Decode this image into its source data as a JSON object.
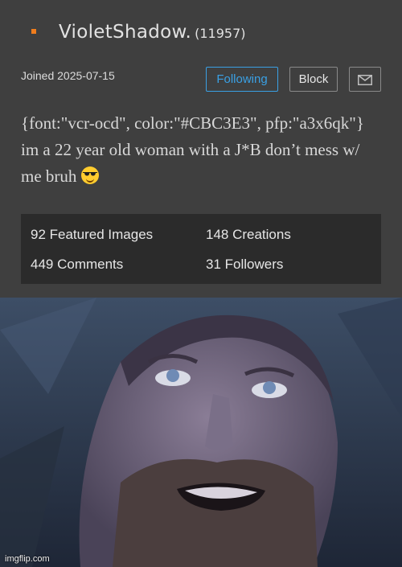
{
  "profile": {
    "username": "VioletShadow.",
    "points": "(11957)",
    "joined": "Joined 2025-07-15",
    "buttons": {
      "following": "Following",
      "block": "Block"
    },
    "bio": "{font:\"vcr-ocd\", color:\"#CBC3E3\", pfp:\"a3x6qk\"} im a 22 year old woman with a J*B don’t mess w/ me bruh",
    "stats": {
      "featured": "92 Featured Images",
      "creations": "148 Creations",
      "comments": "449 Comments",
      "followers": "31 Followers"
    }
  },
  "photo": {
    "watermark": "imgflip.com"
  },
  "icons": {
    "message": "envelope-icon",
    "status": "orange-square-icon",
    "emoji": "sunglasses-emoji"
  },
  "colors": {
    "accent": "#3aa0e4",
    "status": "#f07d1d",
    "panel": "#3f3f3f",
    "stats_bg": "#2b2b2b"
  }
}
